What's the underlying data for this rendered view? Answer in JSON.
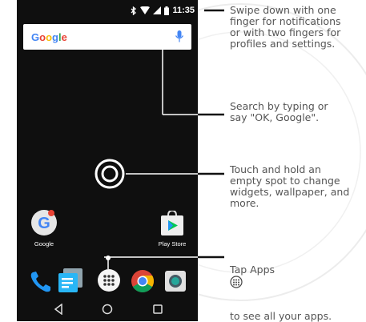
{
  "statusbar": {
    "time": "11:35"
  },
  "search": {
    "logo": "Google",
    "mic_icon": "microphone-icon"
  },
  "apps": [
    {
      "label": "Google",
      "icon": "google-app-icon"
    },
    {
      "label": "Play Store",
      "icon": "play-store-icon"
    }
  ],
  "dock": [
    "phone-icon",
    "messages-icon",
    "apps-launcher-icon",
    "chrome-icon",
    "camera-icon"
  ],
  "navbar": [
    "back-icon",
    "home-icon",
    "recents-icon"
  ],
  "callouts": {
    "notifications": "Swipe down with one\nfinger for notifications\nor with two fingers for\nprofiles and settings.",
    "search": "Search by typing or\nsay \"OK, Google\".",
    "touch": "Touch and hold an\nempty spot to change\nwidgets, wallpaper, and\nmore.",
    "apps_prefix": "Tap Apps",
    "apps_suffix": "to see all your apps."
  },
  "colors": {
    "screen": "#0f0f0f",
    "callout_text": "#555555",
    "accent": "#4285f4"
  }
}
